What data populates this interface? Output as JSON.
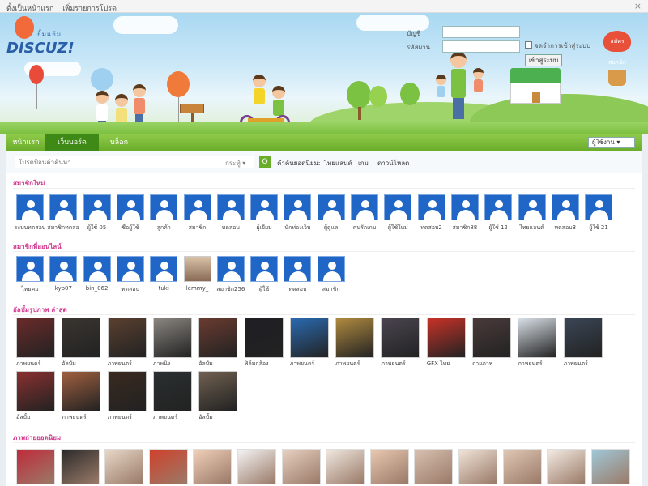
{
  "titlebar": {
    "link1": "ตั้งเป็นหน้าแรก",
    "link2": "เพิ่มรายการโปรด",
    "close": "×"
  },
  "logo": {
    "mark": "ยิ้มแย้ม",
    "word": "DISCUZ!"
  },
  "login": {
    "username_label": "บัญชี",
    "password_label": "รหัสผ่าน",
    "remember_label": "จดจำการเข้าสู่ระบบ",
    "login_button": "เข้าสู่ระบบ",
    "register_label": "สมัครสมาชิก"
  },
  "nav": {
    "tabs": [
      {
        "label": "หน้าแรก"
      },
      {
        "label": "เว็บบอร์ด"
      },
      {
        "label": "บล็อก"
      }
    ],
    "user_menu": "ผู้ใช้งาน ▾"
  },
  "search": {
    "placeholder": "โปรดป้อนคำค้นหา",
    "scope": "กระทู้ ▾",
    "go": "Q",
    "hot_label": "คำค้นยอดนิยม:",
    "hot_terms": [
      "ไทยแลนด์",
      "เกม",
      "ดาวน์โหลด"
    ]
  },
  "sections": {
    "members_title": "สมาชิกใหม่",
    "friends_title": "สมาชิกที่ออนไลน์",
    "albums_title": "อัลบั้มรูปภาพ ล่าสุด",
    "photos_title": "ภาพถ่ายยอดนิยม"
  },
  "members": [
    {
      "name": "ระบบทดสอบ"
    },
    {
      "name": "สมาชิกทดสอบ"
    },
    {
      "name": "ผู้ใช้ 05"
    },
    {
      "name": "ชื่อผู้ใช้"
    },
    {
      "name": "ลูกค้า"
    },
    {
      "name": "สมาชิก"
    },
    {
      "name": "ทดสอบ"
    },
    {
      "name": "ผู้เยี่ยม"
    },
    {
      "name": "นักท่องเว็บ"
    },
    {
      "name": "ผู้ดูแล"
    },
    {
      "name": "คนรักเกม"
    },
    {
      "name": "ผู้ใช้ใหม่"
    },
    {
      "name": "ทดสอบ2"
    },
    {
      "name": "สมาชิก88"
    },
    {
      "name": "ผู้ใช้ 12"
    },
    {
      "name": "ไทยแลนด์"
    },
    {
      "name": "ทดสอบ3"
    },
    {
      "name": "ผู้ใช้ 21"
    }
  ],
  "friends": [
    {
      "name": "ไทยคม"
    },
    {
      "name": "kyb07"
    },
    {
      "name": "bin_062"
    },
    {
      "name": "ทดสอบ"
    },
    {
      "name": "tuki"
    },
    {
      "name": "lemmy_"
    },
    {
      "name": "สมาชิก256"
    },
    {
      "name": "ผู้ใช้"
    },
    {
      "name": "ทดสอบ"
    },
    {
      "name": "สมาชิก"
    }
  ],
  "albums": [
    {
      "name": "ภาพยนตร์"
    },
    {
      "name": "อัลบั้ม"
    },
    {
      "name": "ภาพยนตร์"
    },
    {
      "name": "ภาพนิ่ง"
    },
    {
      "name": "อัลบั้ม"
    },
    {
      "name": "ฟิล์มกล้อง"
    },
    {
      "name": "ภาพยนตร์"
    },
    {
      "name": "ภาพยนตร์"
    },
    {
      "name": "ภาพยนตร์"
    },
    {
      "name": "GFX ไทย"
    },
    {
      "name": "ถ่ายภาพ"
    },
    {
      "name": "ภาพยนตร์"
    },
    {
      "name": "ภาพยนตร์"
    },
    {
      "name": "อัลบั้ม"
    },
    {
      "name": "ภาพยนตร์"
    },
    {
      "name": "ภาพยนตร์"
    },
    {
      "name": "ภาพยนตร์"
    },
    {
      "name": "อัลบั้ม"
    }
  ],
  "photos_count": 14
}
